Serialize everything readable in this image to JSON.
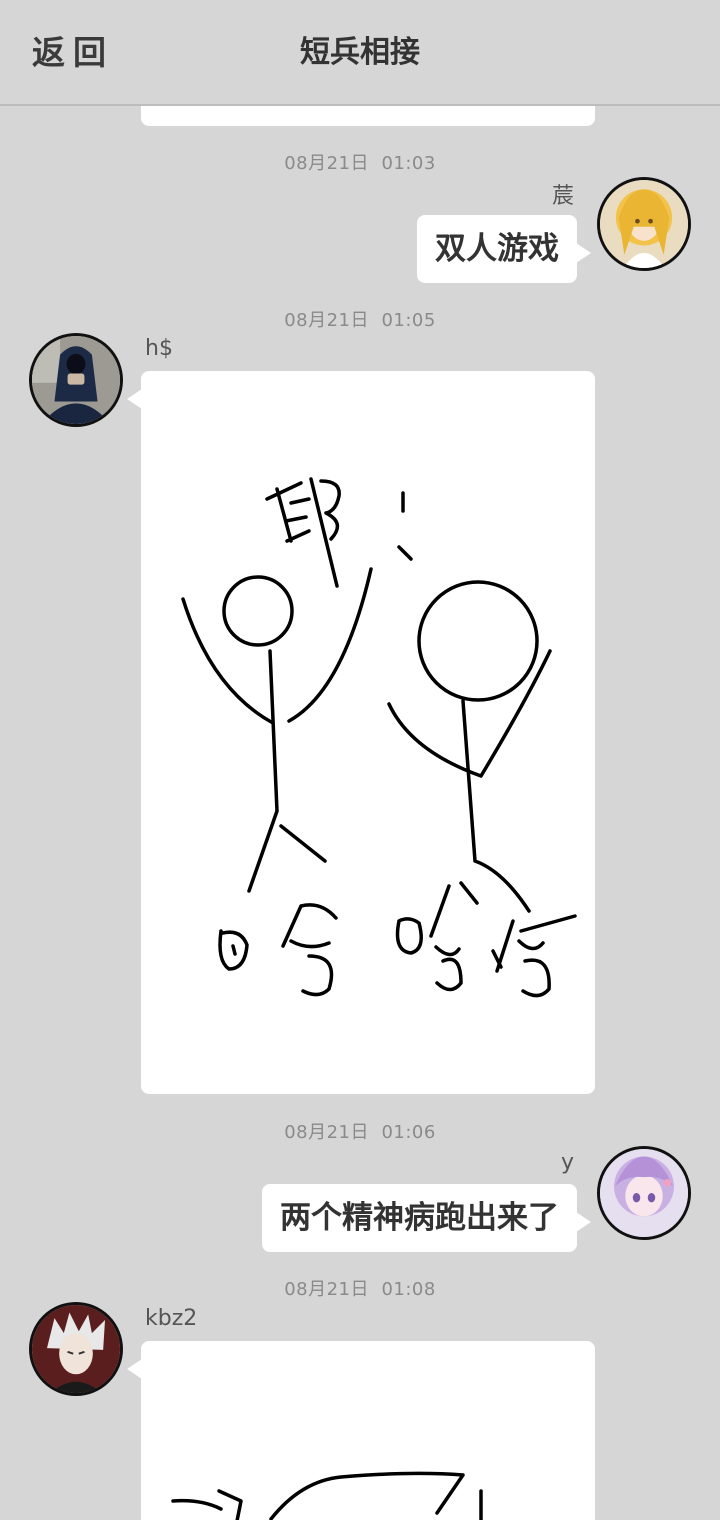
{
  "header": {
    "back_label": "返回",
    "title": "短兵相接"
  },
  "messages": [
    {
      "timestamp": "08月21日  01:03",
      "sender": "莀",
      "side": "right",
      "text": "双人游戏",
      "avatar_icon": "blonde-anime-girl-avatar"
    },
    {
      "timestamp": "08月21日  01:05",
      "sender": "h$",
      "side": "left",
      "image": "stick-figure-drawing",
      "drawing_text": [
        "耶！",
        "哈",
        "哈哈"
      ],
      "avatar_icon": "hooded-person-avatar"
    },
    {
      "timestamp": "08月21日  01:06",
      "sender": "y",
      "side": "right",
      "text": "两个精神病跑出来了",
      "avatar_icon": "purple-haired-anime-girl-avatar"
    },
    {
      "timestamp": "08月21日  01:08",
      "sender": "kbz2",
      "side": "left",
      "image": "hand-drawing",
      "avatar_icon": "white-haired-anime-boy-avatar"
    }
  ],
  "colors": {
    "background": "#d6d6d6",
    "bubble": "#ffffff",
    "text": "#333333",
    "timestamp": "#8a8a8a"
  }
}
